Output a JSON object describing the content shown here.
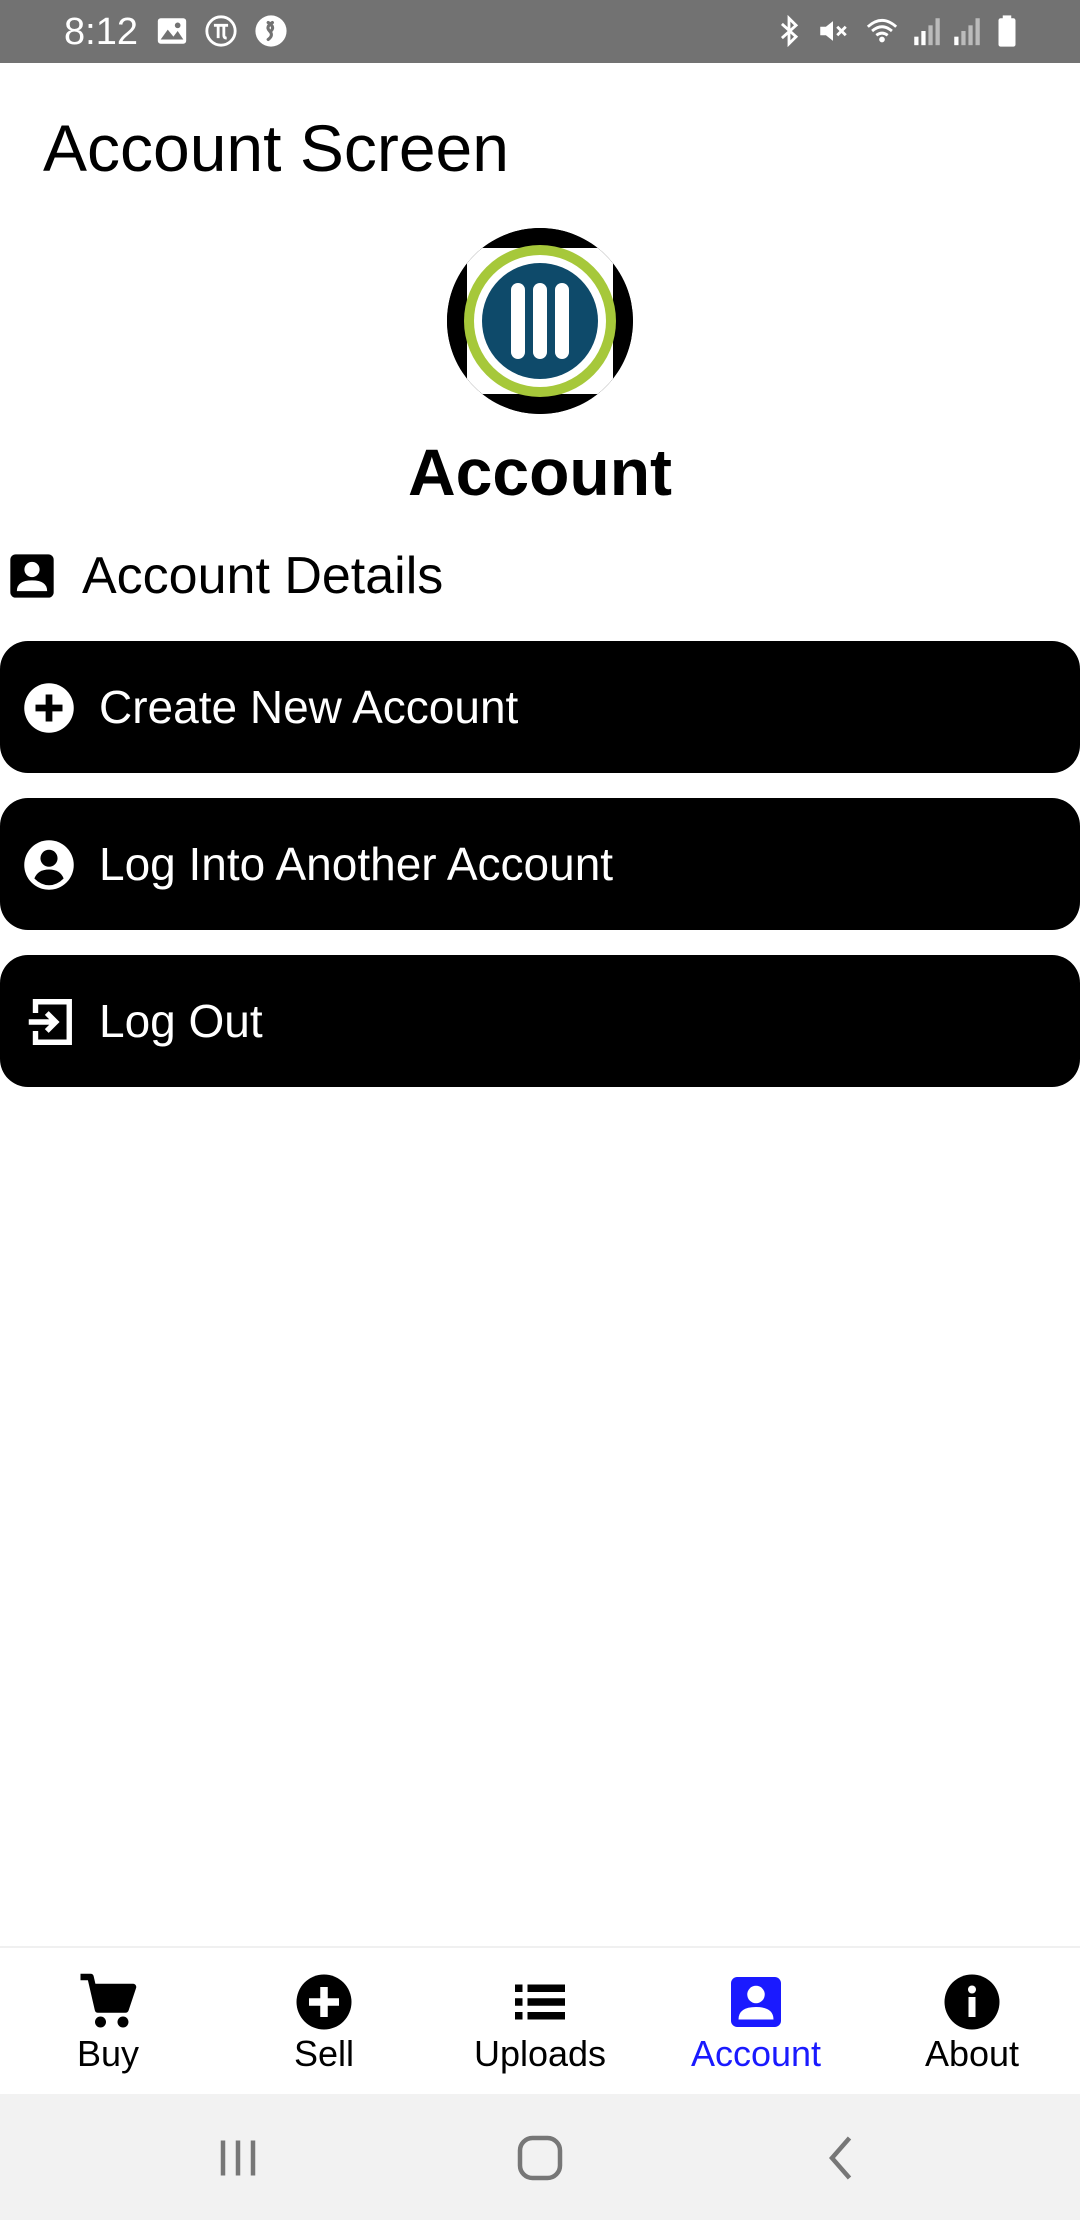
{
  "status_bar": {
    "time": "8:12",
    "left_icons": [
      "gallery-icon",
      "pi-icon",
      "shazam-icon"
    ],
    "right_icons": [
      "bluetooth-icon",
      "mute-icon",
      "wifi-icon",
      "signal-icon",
      "signal-icon",
      "battery-icon"
    ]
  },
  "header": {
    "title": "Account Screen"
  },
  "profile": {
    "heading": "Account",
    "logo_icon": "app-logo-icon"
  },
  "details": {
    "label": "Account Details",
    "icon": "account-box-icon"
  },
  "actions": [
    {
      "label": "Create New Account",
      "icon": "add-circle-icon"
    },
    {
      "label": "Log Into Another Account",
      "icon": "account-circle-icon"
    },
    {
      "label": "Log Out",
      "icon": "logout-icon"
    }
  ],
  "bottom_nav": {
    "active": "Account",
    "active_color": "#1a1aff",
    "items": [
      {
        "label": "Buy",
        "icon": "cart-icon"
      },
      {
        "label": "Sell",
        "icon": "add-circle-icon"
      },
      {
        "label": "Uploads",
        "icon": "list-icon"
      },
      {
        "label": "Account",
        "icon": "account-box-icon"
      },
      {
        "label": "About",
        "icon": "info-icon"
      }
    ]
  },
  "colors": {
    "status_bar": "#727272",
    "button_bg": "#000000",
    "button_text": "#ffffff",
    "logo_ring": "#a6c83a",
    "logo_core": "#0e4a6a"
  }
}
